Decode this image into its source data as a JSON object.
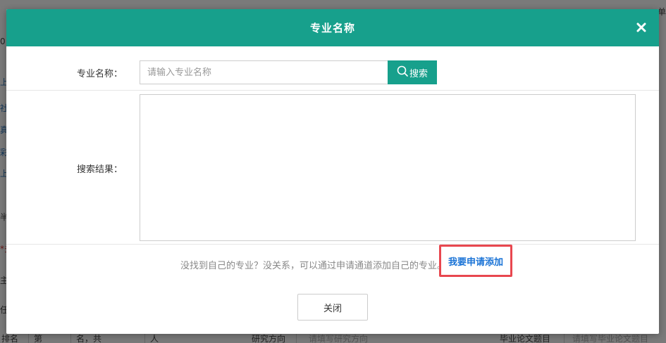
{
  "background": {
    "left_glyphs": [
      "0",
      "上",
      "社",
      "真",
      "彩",
      "上",
      "半",
      "*多",
      "主",
      "任"
    ],
    "top_right": "单",
    "bottom_row": {
      "col1": "排名",
      "col2": "第",
      "col3": "名，共",
      "col4": "人",
      "research_label": "研究方向",
      "research_placeholder": "请填写研究方向",
      "thesis_label": "毕业论文题目",
      "thesis_placeholder": "请填写毕业论文题目"
    }
  },
  "modal": {
    "title": "专业名称",
    "search": {
      "label": "专业名称：",
      "placeholder": "请输入专业名称",
      "value": "",
      "button_label": "搜索"
    },
    "results": {
      "label": "搜索结果："
    },
    "hint": {
      "text": "没找到自己的专业？没关系，可以通过申请通道添加自己的专业。",
      "link_label": "我要申请添加"
    },
    "close_button_label": "关闭"
  },
  "colors": {
    "header": "#17a08c",
    "link": "#1a73d6",
    "highlight_border": "#e8474f"
  }
}
